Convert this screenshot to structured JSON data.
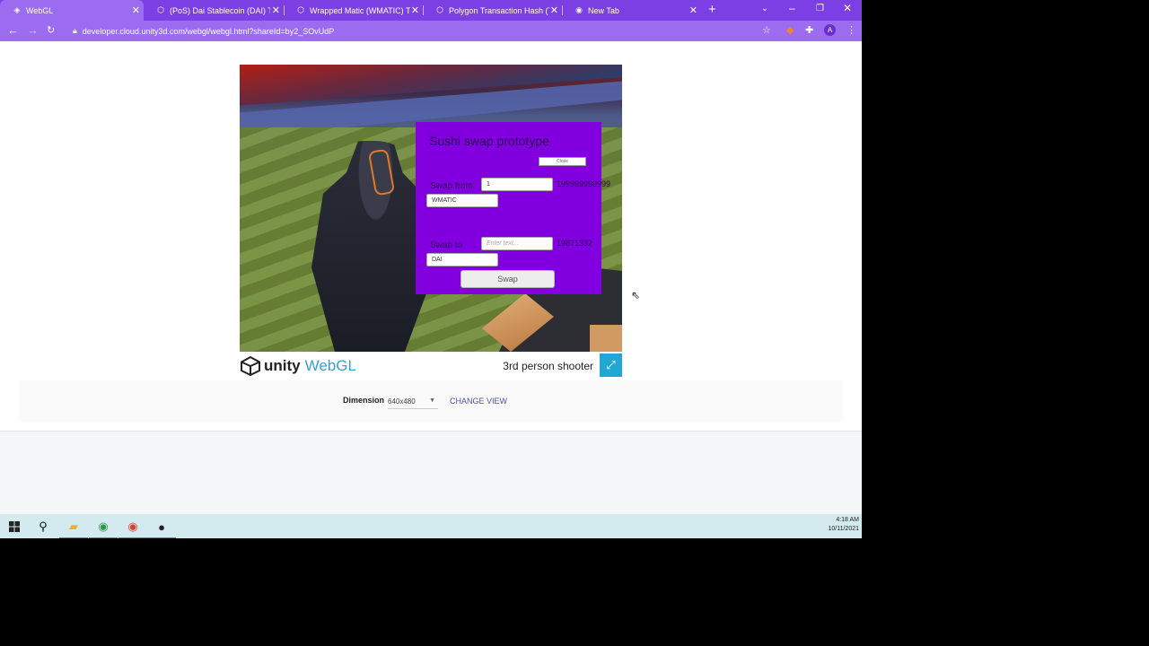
{
  "browser": {
    "tabs": [
      {
        "title": "WebGL",
        "active": true,
        "icon": "unity-icon"
      },
      {
        "title": "(PoS) Dai Stablecoin (DAI) Toke",
        "active": false,
        "icon": "polygon-icon"
      },
      {
        "title": "Wrapped Matic (WMATIC) Toke",
        "active": false,
        "icon": "polygon-icon"
      },
      {
        "title": "Polygon Transaction Hash (Txha",
        "active": false,
        "icon": "polygon-icon"
      },
      {
        "title": "New Tab",
        "active": false,
        "icon": "chrome-icon"
      }
    ],
    "url": "developer.cloud.unity3d.com/webgl/webgl.html?shareId=by2_SOvUdP",
    "profile_initial": "A"
  },
  "game": {
    "panel_title": "Sushi swap prototype",
    "close_label": "Close",
    "swap_from_label": "Swap from",
    "swap_from_value": "1",
    "swap_from_balance": "199999999999",
    "swap_from_token": "WMATIC",
    "swap_to_label": "Swap to",
    "swap_to_placeholder": "Enter text...",
    "swap_to_balance": "19871332",
    "swap_to_token": "DAI",
    "swap_button": "Swap"
  },
  "unity_footer": {
    "brand_unity": "unity",
    "brand_webgl": "WebGL",
    "game_name": "3rd person shooter"
  },
  "dimension": {
    "label": "Dimension",
    "value": "640x480",
    "change_view": "CHANGE VIEW"
  },
  "taskbar": {
    "time": "4:18 AM",
    "date": "10/11/2021"
  }
}
